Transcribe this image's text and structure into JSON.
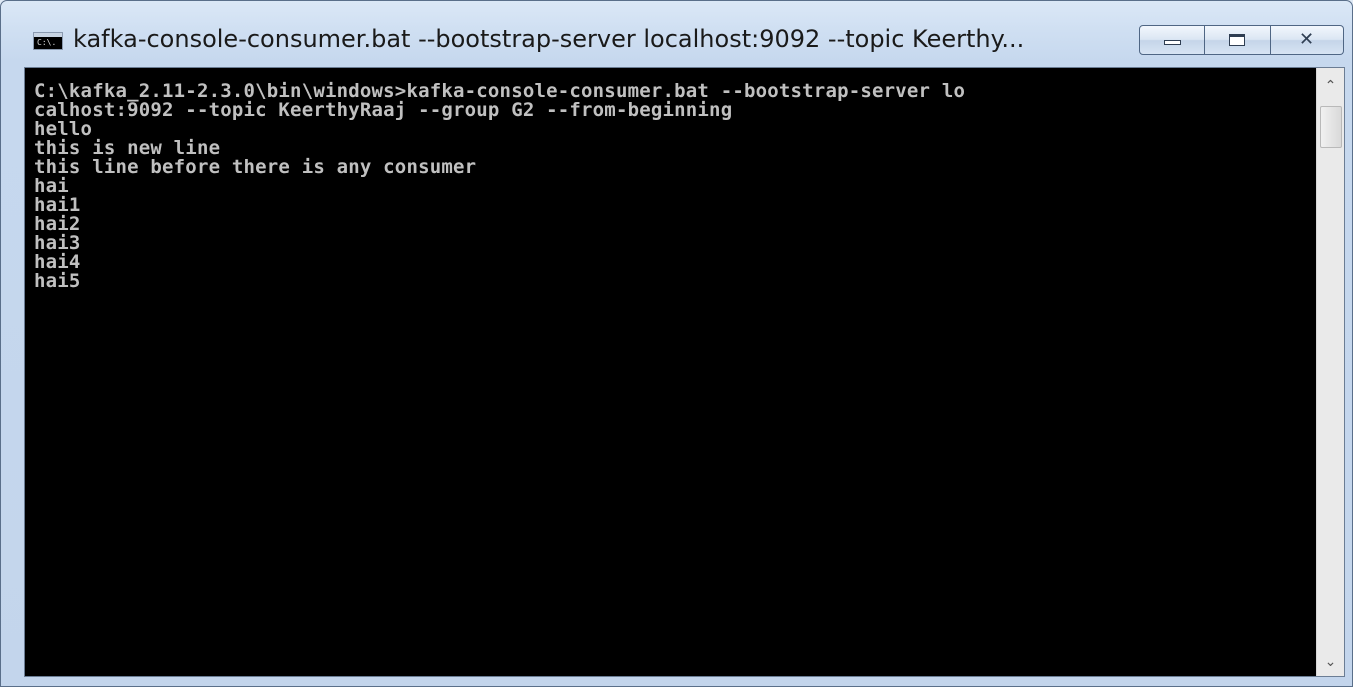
{
  "window": {
    "title": "kafka-console-consumer.bat  --bootstrap-server localhost:9092 --topic Keerthy...",
    "icon": "cmd-icon",
    "icon_glyph": "C:\\.",
    "controls": {
      "minimize": "minimize-icon",
      "maximize": "maximize-icon",
      "close": "close-icon",
      "close_glyph": "✕"
    }
  },
  "console": {
    "background": "#000000",
    "foreground": "#c0c0c0",
    "lines": [
      "C:\\kafka_2.11-2.3.0\\bin\\windows>kafka-console-consumer.bat --bootstrap-server lo",
      "calhost:9092 --topic KeerthyRaaj --group G2 --from-beginning",
      "hello",
      "this is new line",
      "this line before there is any consumer",
      "hai",
      "hai1",
      "hai2",
      "hai3",
      "hai4",
      "hai5"
    ]
  },
  "scrollbar": {
    "up_arrow": "⌃",
    "down_arrow": "⌄",
    "position": 0
  }
}
